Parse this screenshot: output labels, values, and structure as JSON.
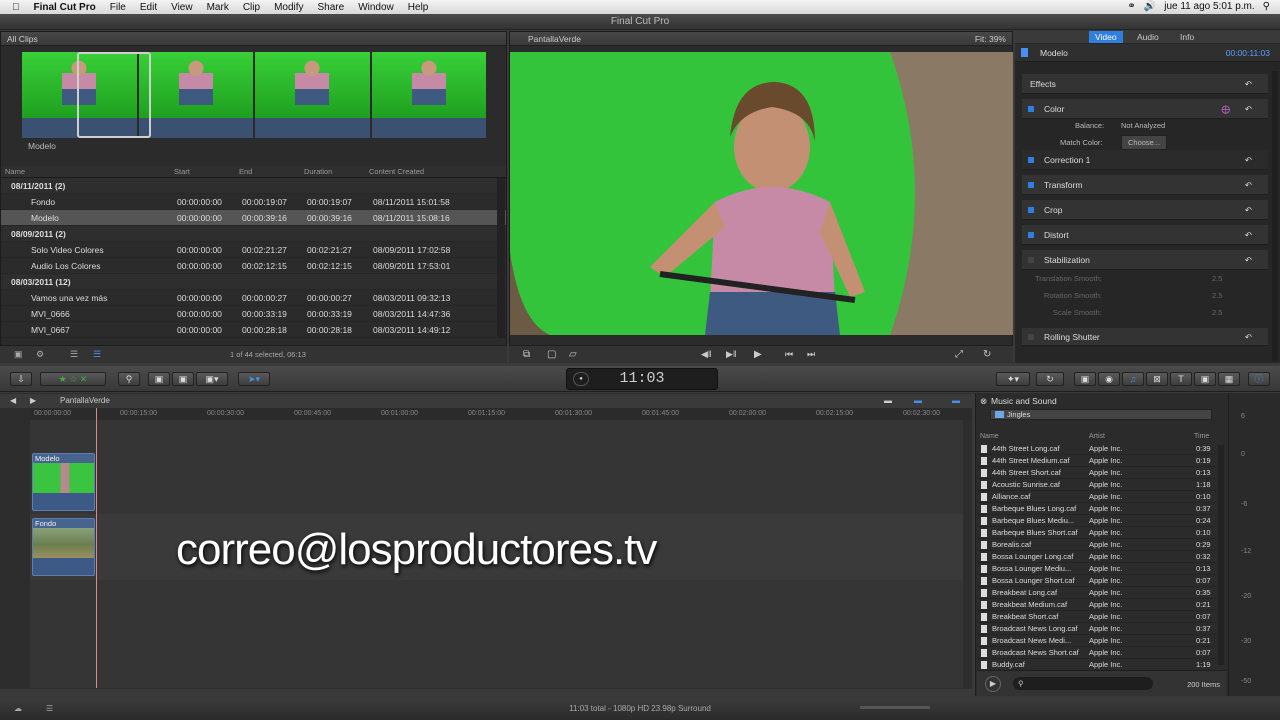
{
  "menubar": {
    "app": "Final Cut Pro",
    "items": [
      "File",
      "Edit",
      "View",
      "Mark",
      "Clip",
      "Modify",
      "Share",
      "Window",
      "Help"
    ],
    "clock": "jue 11 ago  5:01 p.m."
  },
  "window_title": "Final Cut Pro",
  "library": {
    "header": "All Clips",
    "filmstrip_label": "Modelo",
    "columns": [
      "Name",
      "Start",
      "End",
      "Duration",
      "Content Created"
    ],
    "rows": [
      {
        "type": "group",
        "name": "08/11/2011  (2)"
      },
      {
        "type": "clip",
        "name": "Fondo",
        "start": "00:00:00:00",
        "end": "00:00:19:07",
        "duration": "00:00:19:07",
        "created": "08/11/2011 15:01:58"
      },
      {
        "type": "clip",
        "name": "Modelo",
        "start": "00:00:00:00",
        "end": "00:00:39:16",
        "duration": "00:00:39:16",
        "created": "08/11/2011 15:08:16",
        "selected": true
      },
      {
        "type": "group",
        "name": "08/09/2011  (2)"
      },
      {
        "type": "clip",
        "name": "Solo Video Colores",
        "start": "00:00:00:00",
        "end": "00:02:21:27",
        "duration": "00:02:21:27",
        "created": "08/09/2011 17:02:58"
      },
      {
        "type": "clip",
        "name": "Audio Los Colores",
        "start": "00:00:00:00",
        "end": "00:02:12:15",
        "duration": "00:02:12:15",
        "created": "08/09/2011 17:53:01"
      },
      {
        "type": "group",
        "name": "08/03/2011  (12)"
      },
      {
        "type": "clip",
        "name": "Vamos una vez más",
        "start": "00:00:00:00",
        "end": "00:00:00:27",
        "duration": "00:00:00:27",
        "created": "08/03/2011 09:32:13"
      },
      {
        "type": "clip",
        "name": "MVI_0666",
        "start": "00:00:00:00",
        "end": "00:00:33:19",
        "duration": "00:00:33:19",
        "created": "08/03/2011 14:47:36"
      },
      {
        "type": "clip",
        "name": "MVI_0667",
        "start": "00:00:00:00",
        "end": "00:00:28:18",
        "duration": "00:00:28:18",
        "created": "08/03/2011 14:49:12"
      }
    ],
    "footer": "1 of 44 selected, 06:13"
  },
  "viewer": {
    "title": "PantallaVerde",
    "fit": "Fit:  39%"
  },
  "inspector": {
    "tabs": [
      "Video",
      "Audio",
      "Info"
    ],
    "clip": "Modelo",
    "timecode": "00:00:11:03",
    "effects": "Effects",
    "color": "Color",
    "balance_label": "Balance:",
    "balance_value": "Not Analyzed",
    "match_label": "Match Color:",
    "match_button": "Choose...",
    "correction": "Correction 1",
    "transform": "Transform",
    "crop": "Crop",
    "distort": "Distort",
    "stabilization": "Stabilization",
    "trans_smooth": "Translation Smooth:",
    "rot_smooth": "Rotation Smooth:",
    "scale_smooth": "Scale Smooth:",
    "smooth_val": "2.5",
    "rolling": "Rolling Shutter"
  },
  "timecode": "11:03",
  "timeline": {
    "project": "PantallaVerde",
    "ruler": [
      "00:00:00:00",
      "00:00:15:00",
      "00:00:30:00",
      "00:00:45:00",
      "00:01:00:00",
      "00:01:15:00",
      "00:01:30:00",
      "00:01:45:00",
      "00:02:00:00",
      "00:02:15:00",
      "00:02:30:00"
    ],
    "clip_top": "Modelo",
    "clip_bottom": "Fondo",
    "overlay": "correo@losproductores.tv"
  },
  "music": {
    "title": "Music and Sound",
    "folder": "Jingles",
    "columns": [
      "Name",
      "Artist",
      "Time"
    ],
    "items": [
      [
        "44th Street Long.caf",
        "Apple Inc.",
        "0:39"
      ],
      [
        "44th Street Medium.caf",
        "Apple Inc.",
        "0:19"
      ],
      [
        "44th Street Short.caf",
        "Apple Inc.",
        "0:13"
      ],
      [
        "Acoustic Sunrise.caf",
        "Apple Inc.",
        "1:18"
      ],
      [
        "Alliance.caf",
        "Apple Inc.",
        "0:10"
      ],
      [
        "Barbeque Blues Long.caf",
        "Apple Inc.",
        "0:37"
      ],
      [
        "Barbeque Blues Mediu...",
        "Apple Inc.",
        "0:24"
      ],
      [
        "Barbeque Blues Short.caf",
        "Apple Inc.",
        "0:10"
      ],
      [
        "Borealis.caf",
        "Apple Inc.",
        "0:29"
      ],
      [
        "Bossa Lounger Long.caf",
        "Apple Inc.",
        "0:32"
      ],
      [
        "Bossa Lounger Mediu...",
        "Apple Inc.",
        "0:13"
      ],
      [
        "Bossa Lounger Short.caf",
        "Apple Inc.",
        "0:07"
      ],
      [
        "Breakbeat Long.caf",
        "Apple Inc.",
        "0:35"
      ],
      [
        "Breakbeat Medium.caf",
        "Apple Inc.",
        "0:21"
      ],
      [
        "Breakbeat Short.caf",
        "Apple Inc.",
        "0:07"
      ],
      [
        "Broadcast News Long.caf",
        "Apple Inc.",
        "0:37"
      ],
      [
        "Broadcast News Medi...",
        "Apple Inc.",
        "0:21"
      ],
      [
        "Broadcast News Short.caf",
        "Apple Inc.",
        "0:07"
      ],
      [
        "Buddy.caf",
        "Apple Inc.",
        "1:19"
      ]
    ],
    "count": "200 Items"
  },
  "meter_labels": [
    "6",
    "0",
    "-6",
    "-12",
    "-20",
    "-30",
    "-50"
  ],
  "status": "11:03 total - 1080p HD 23.98p Surround"
}
